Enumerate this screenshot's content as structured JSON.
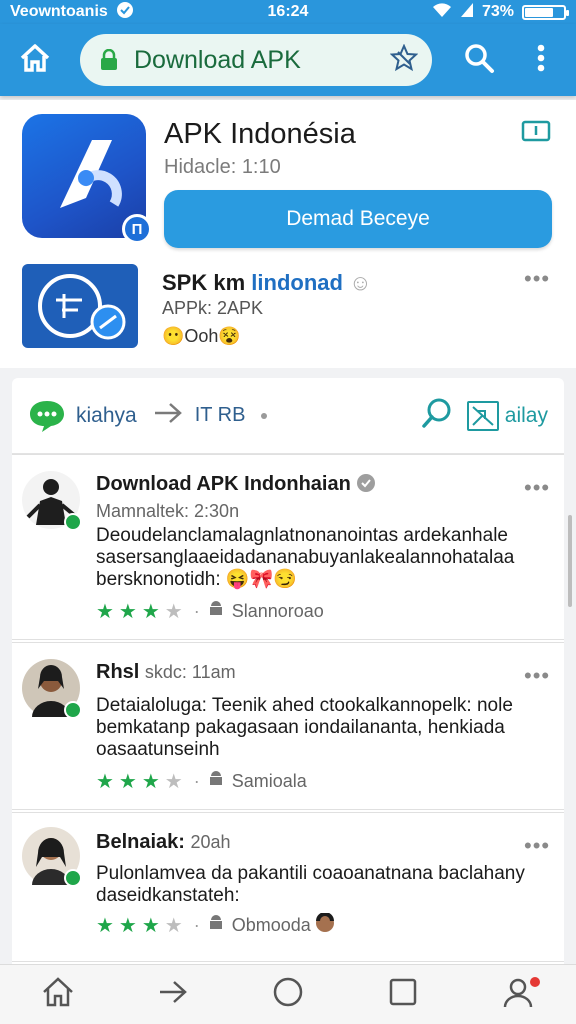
{
  "status_bar": {
    "carrier": "Veowntoanis",
    "time": "16:24",
    "battery_text": "73%",
    "battery_level": 0.73
  },
  "app_bar": {
    "url": "Download APK",
    "icons": [
      "home-icon",
      "lock-icon",
      "bookmark-star-icon",
      "search-icon",
      "more-vert-icon"
    ]
  },
  "app": {
    "title": "APK Indonésia",
    "subtitle": "Hidacle: 1:10",
    "download_button": "Demad Beceye",
    "badge": "П"
  },
  "related": {
    "title_prefix": "SPK km",
    "title_accent": "lindonad",
    "subtitle": "APPk: 2APK",
    "emoji_line": "😶Ooh😵"
  },
  "actions": {
    "label": "kiahya",
    "size": "IT RB",
    "share_label": "ailay"
  },
  "reviews": [
    {
      "name": "Download APK Indonhaian",
      "date": "Mamnaltek: 2:30n",
      "text": "Deoudelanclamalagnlatnonanointas ardekanhale sasersanglaaeidadananabuyanlakealannohatalaa bersknonotidh: 😝🎀😏",
      "rating": 3,
      "meta": "Slannoroao"
    },
    {
      "name": "Rhsl",
      "date_inline": "skdc: 11am",
      "text": "Detaialoluga: Teenik ahed ctookalkannopelk: nole bemkatanp pakagasaan iondailananta, henkiada oasaatunseinh",
      "rating": 3,
      "meta": "Samioala"
    },
    {
      "name": "Belnaiak:",
      "date_inline": "20ah",
      "text": "Pulonlamvea da pakantili coaoanatnana baclahany daseidkanstateh:",
      "rating": 3,
      "meta": "Obmooda"
    }
  ],
  "colors": {
    "brand_blue": "#2a96dc",
    "url_green": "#1a6b3d",
    "star_green": "#1fa64a",
    "teal": "#1e9aa0"
  }
}
